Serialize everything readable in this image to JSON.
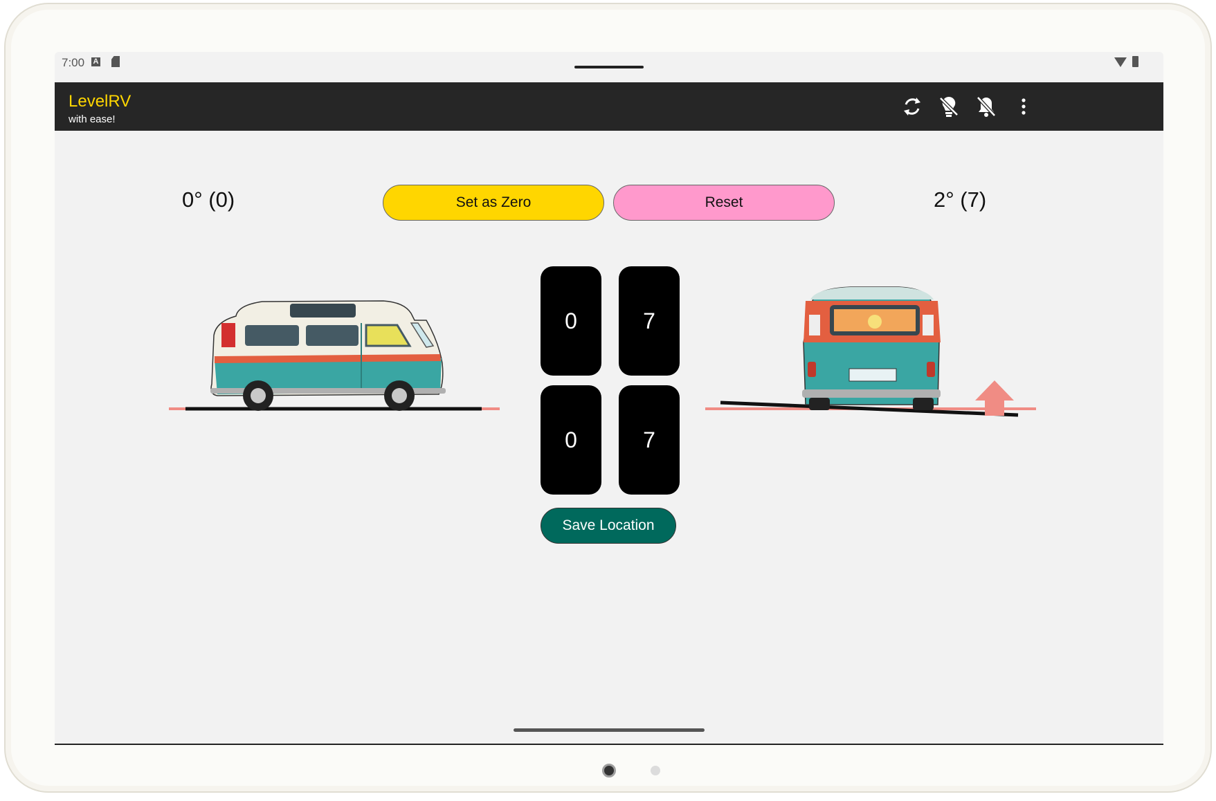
{
  "status_bar": {
    "time": "7:00",
    "a_icon_letter": "A"
  },
  "app_bar": {
    "title": "LevelRV",
    "subtitle": "with ease!",
    "actions": [
      "sync-icon",
      "light-off-icon",
      "notifications-off-icon",
      "more-vert-icon"
    ]
  },
  "left_angle": "0° (0)",
  "right_angle": "2° (7)",
  "set_zero_label": "Set as Zero",
  "reset_label": "Reset",
  "tiles": {
    "top_left": "0",
    "top_right": "7",
    "bottom_left": "0",
    "bottom_right": "7"
  },
  "save_location_label": "Save Location",
  "colors": {
    "title_yellow": "#ffd600",
    "set_zero_bg": "#ffd600",
    "reset_bg": "#ff99cc",
    "save_bg": "#00695c",
    "level_line": "#f08c84",
    "arrow": "#f08c84",
    "app_bar_bg": "#262626"
  }
}
